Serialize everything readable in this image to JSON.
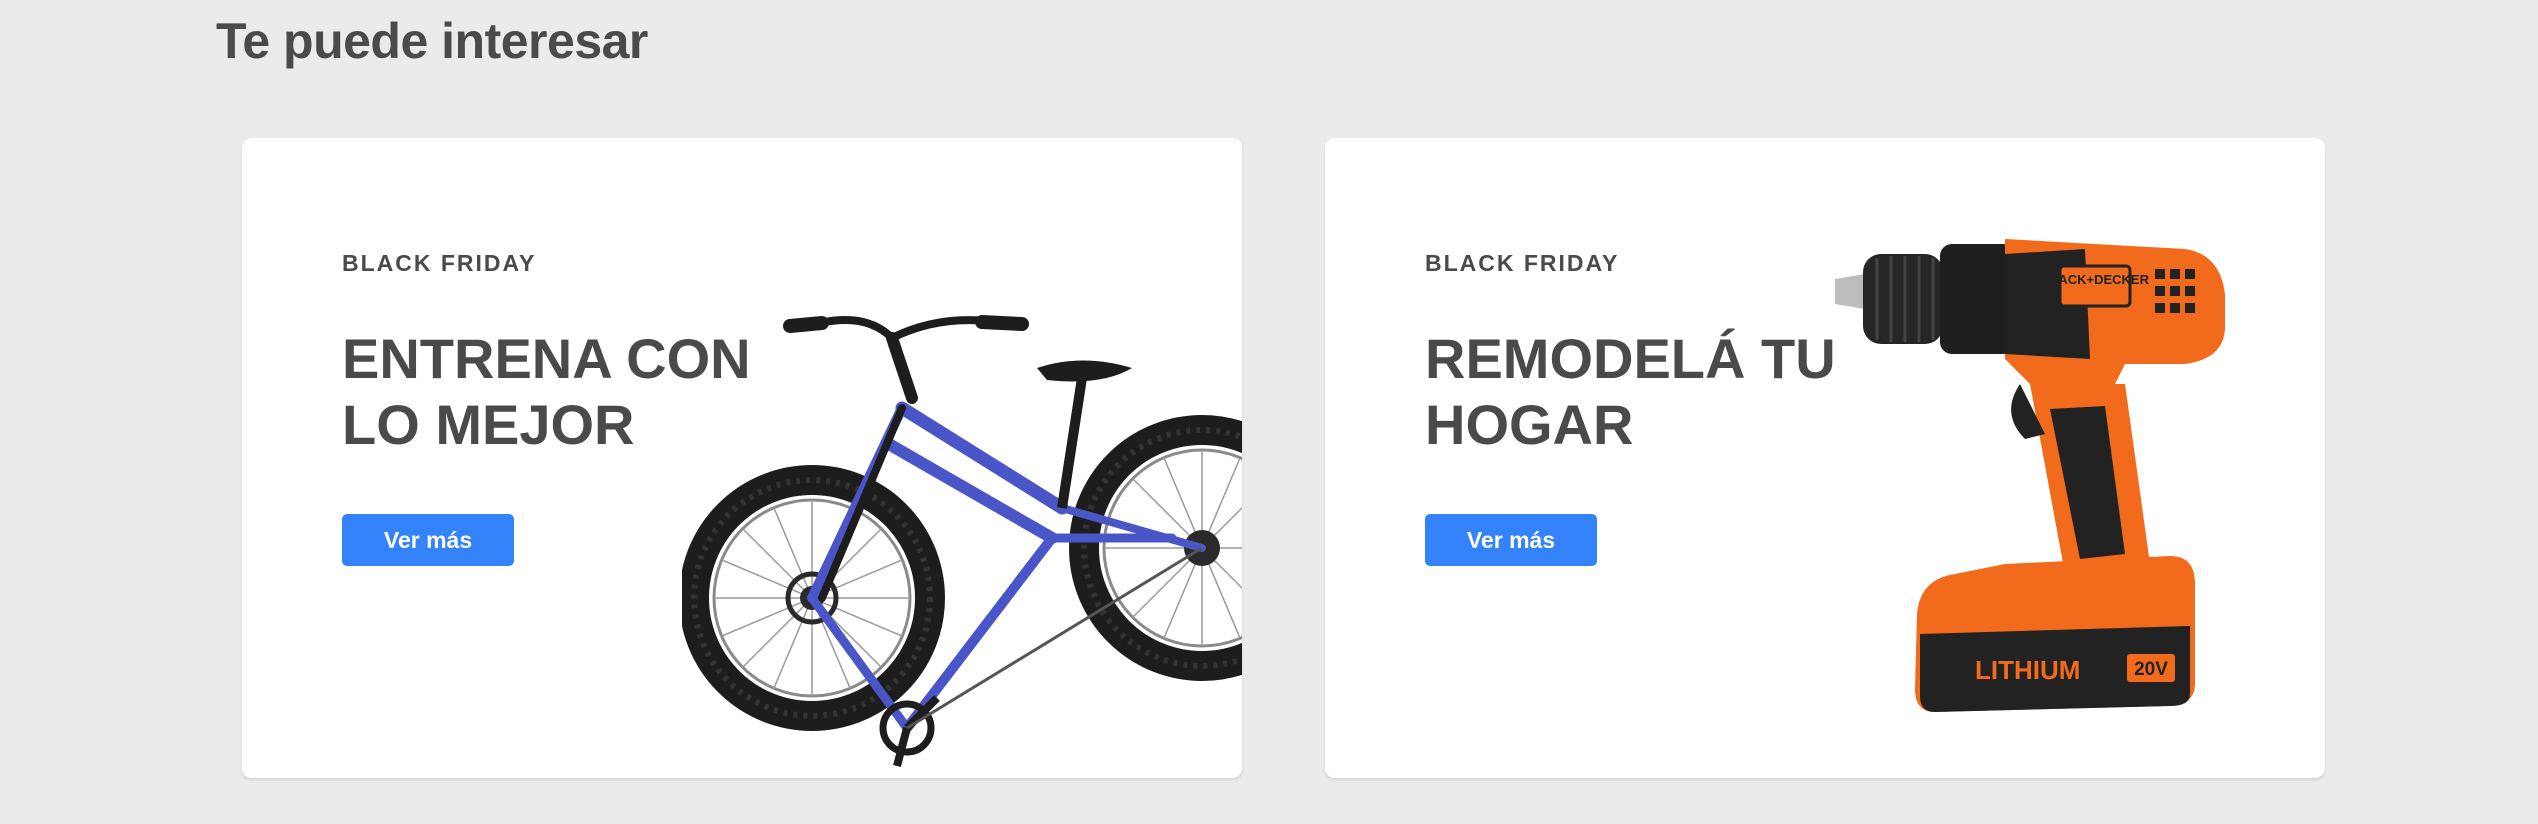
{
  "section": {
    "title": "Te puede interesar"
  },
  "cards": [
    {
      "eyebrow": "BLACK FRIDAY",
      "headline_line1": "ENTRENA CON",
      "headline_line2": "LO MEJOR",
      "button_label": "Ver más",
      "image": "fat-tire-bicycle"
    },
    {
      "eyebrow": "BLACK FRIDAY",
      "headline_line1": "REMODELÁ TU",
      "headline_line2": "HOGAR",
      "button_label": "Ver más",
      "image": "cordless-drill",
      "image_brand": "BLACK+DECKER",
      "image_battery_text": "LITHIUM",
      "image_voltage_text": "20V"
    }
  ],
  "colors": {
    "page_background": "#ebebeb",
    "card_background": "#ffffff",
    "text": "#4a4a4a",
    "button": "#3483fa",
    "bike_frame": "#4a56c8",
    "drill_orange": "#f26b1d"
  }
}
